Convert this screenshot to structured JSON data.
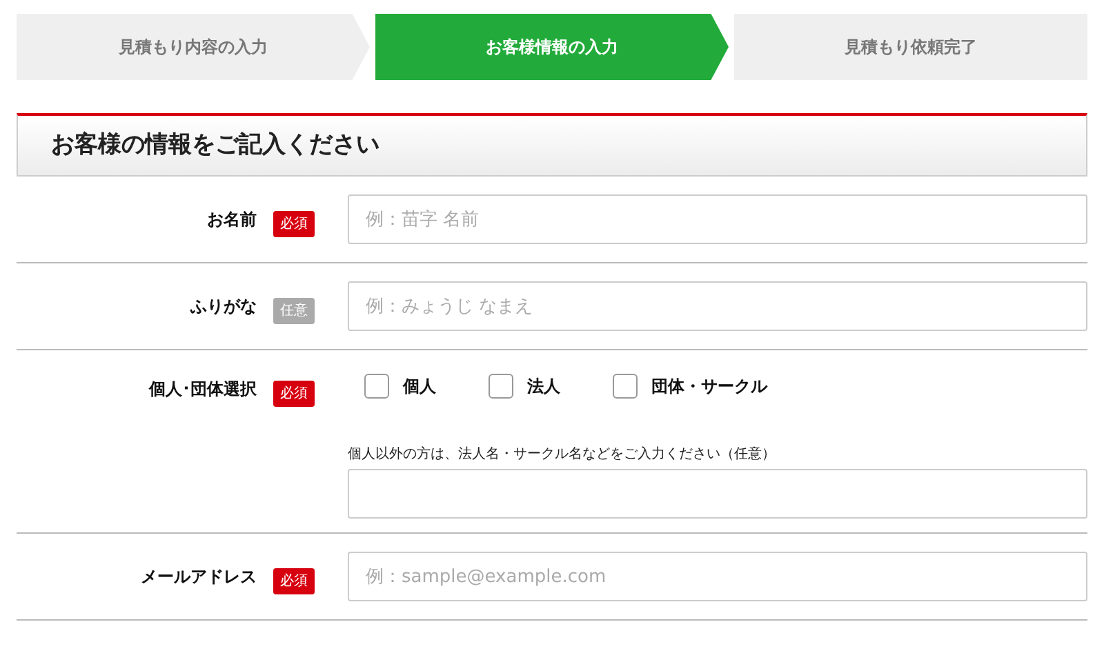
{
  "steps": [
    {
      "label": "見積もり内容の入力",
      "selected": false
    },
    {
      "label": "お客様情報の入力",
      "selected": true
    },
    {
      "label": "見積もり依頼完了",
      "selected": false
    }
  ],
  "section_title": "お客様の情報をご記入ください",
  "rows": [
    {
      "kind": "text",
      "label": "お名前",
      "badge": "必須",
      "required": true,
      "placeholder": "例：苗字 名前"
    },
    {
      "kind": "text",
      "label": "ふりがな",
      "badge": "任意",
      "required": false,
      "placeholder": "例：みょうじ なまえ"
    },
    {
      "kind": "choice",
      "label": "個人･団体選択",
      "badge": "必須",
      "required": true,
      "options": [
        {
          "label": "個人",
          "checked": false
        },
        {
          "label": "法人",
          "checked": false
        },
        {
          "label": "団体・サークル",
          "checked": false
        }
      ],
      "note": "個人以外の方は、法人名・サークル名などをご入力ください（任意）"
    },
    {
      "kind": "text",
      "label": "メールアドレス",
      "badge": "必須",
      "required": true,
      "placeholder": "例：sample@example.com"
    }
  ]
}
